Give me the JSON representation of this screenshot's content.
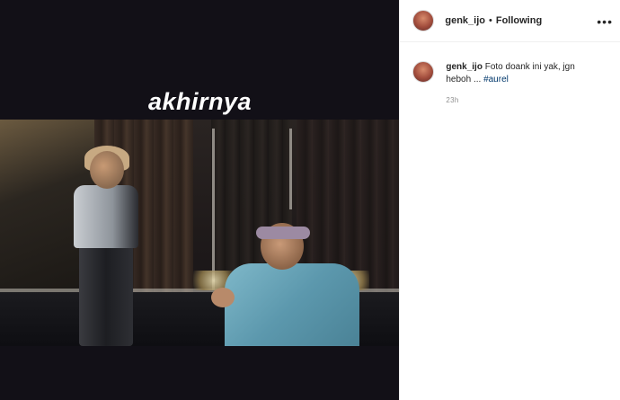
{
  "media": {
    "story_caption": "akhirnya"
  },
  "header": {
    "username": "genk_ijo",
    "separator": "•",
    "follow_status": "Following",
    "more_icon": "more-horizontal-icon"
  },
  "caption": {
    "username": "genk_ijo",
    "text": "Foto doank ini yak, jgn heboh ...",
    "hashtag": "#aurel",
    "timestamp": "23h"
  },
  "colors": {
    "hashtag": "#00376b",
    "muted": "#8e8e8e",
    "border": "#efefef"
  }
}
